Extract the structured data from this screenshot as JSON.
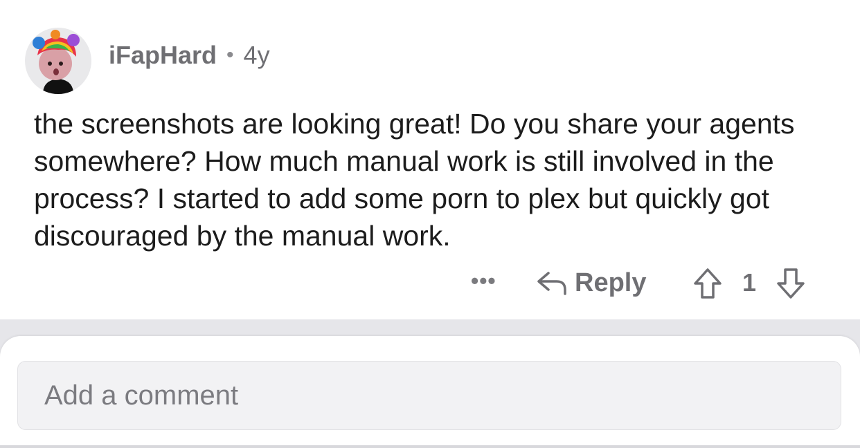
{
  "comment": {
    "username": "iFapHard",
    "separator": "•",
    "age": "4y",
    "body": "the screenshots are looking great! Do you share your agents somewhere? How much manual work is still involved in the process? I started to add some porn to plex but quickly got discouraged by the manual work.",
    "actions": {
      "more_label": "•••",
      "reply_label": "Reply",
      "score": "1"
    }
  },
  "composer": {
    "placeholder": "Add a comment"
  },
  "colors": {
    "meta_text": "#6f6f73",
    "body_text": "#1c1c1c",
    "divider_bg": "#e6e6ea",
    "input_bg": "#f2f2f4"
  },
  "icons": {
    "avatar": "snoo-avatar-rainbow-hair",
    "reply": "reply-arrow-icon",
    "upvote": "upvote-arrow-icon",
    "downvote": "downvote-arrow-icon"
  }
}
